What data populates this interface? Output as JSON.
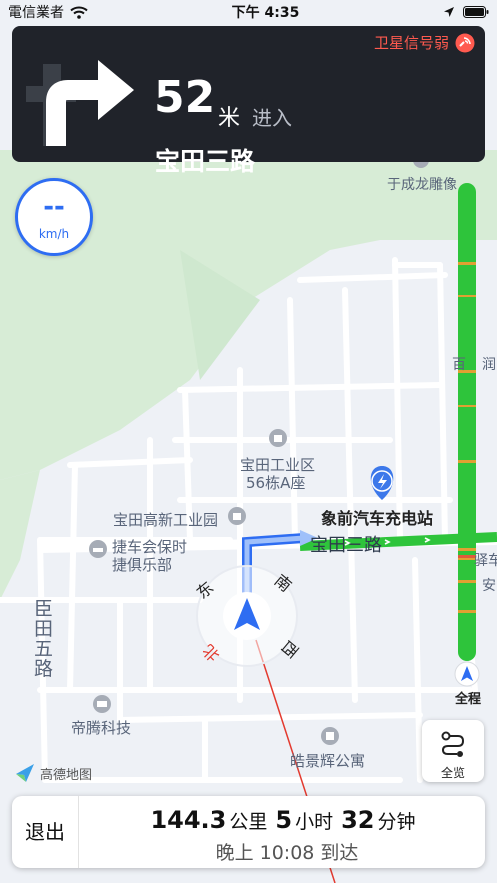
{
  "status_bar": {
    "carrier": "電信業者",
    "time": "下午 4:35"
  },
  "guidance": {
    "distance": "52",
    "unit": "米",
    "action": "进入",
    "road": "宝田三路",
    "gps_warning": "卫星信号弱"
  },
  "speed": {
    "value": "--",
    "unit": "km/h"
  },
  "progress": {
    "label": "全程"
  },
  "overview": {
    "label": "全览"
  },
  "brand": {
    "logo_text": "高德地图"
  },
  "compass": {
    "east": "东",
    "south": "南",
    "west": "西",
    "north": "北"
  },
  "map_labels": {
    "yuchenglong": "于成龙雕像",
    "bt_industrial_1": "宝田工业区",
    "bt_industrial_2": "56栋A座",
    "gaoxin_park": "宝田高新工业园",
    "charging": "象前汽车充电站",
    "porsche_1": "捷车会保时",
    "porsche_2": "捷俱乐部",
    "road_3": "宝田三路",
    "chentian_1": "臣",
    "chentian_2": "田",
    "chentian_3": "五",
    "chentian_4": "路",
    "diteng": "帝腾科技",
    "haojing": "皓景辉公寓",
    "edge_1": "百",
    "edge_2": "润",
    "edge_3": "驿车",
    "edge_4": "安"
  },
  "trip": {
    "distance": "144.3",
    "distance_unit": "公里",
    "hours": "5",
    "hours_unit": "小时",
    "minutes": "32",
    "minutes_unit": "分钟",
    "arrival": "晚上 10:08 到达",
    "exit_label": "退出"
  },
  "colors": {
    "accent": "#2e6df2",
    "traffic_green": "#2ec43b",
    "warning": "#ff5a4f",
    "card_bg": "#20232a"
  }
}
